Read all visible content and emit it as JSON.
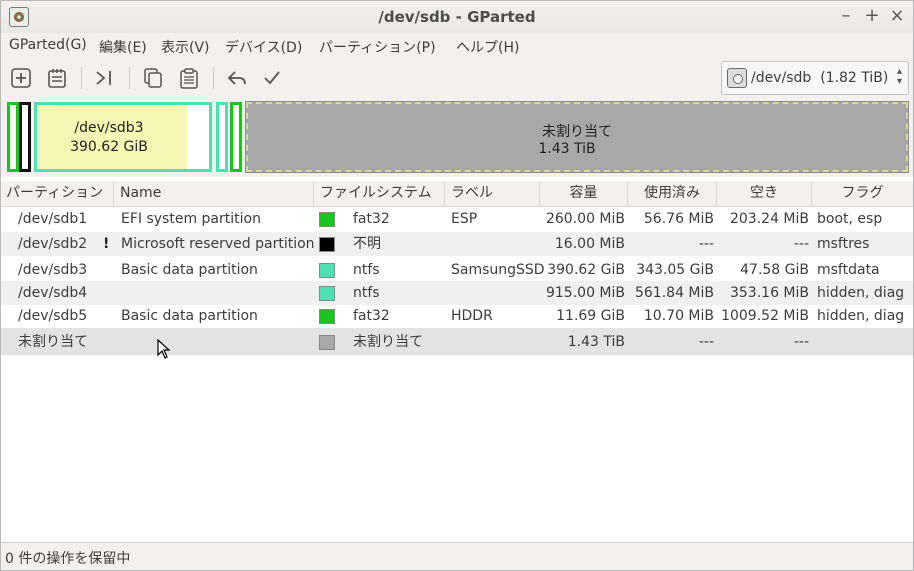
{
  "window": {
    "title": "/dev/sdb - GParted"
  },
  "menubar": {
    "items": [
      "GParted(G)",
      "編集(E)",
      "表示(V)",
      "デバイス(D)",
      "パーティション(P)",
      "ヘルプ(H)"
    ]
  },
  "toolbar": {
    "buttons": [
      "new-partition",
      "delete-partition",
      "resize-move",
      "copy",
      "paste",
      "undo",
      "apply"
    ],
    "device": "/dev/sdb",
    "device_size": "(1.82 TiB)"
  },
  "diskmap": {
    "sdb3": {
      "name": "/dev/sdb3",
      "size": "390.62 GiB"
    },
    "unallocated": {
      "name": "未割り当て",
      "size": "1.43 TiB"
    }
  },
  "table": {
    "headers": [
      "パーティション",
      "Name",
      "ファイルシステム",
      "ラベル",
      "容量",
      "使用済み",
      "空き",
      "フラグ"
    ],
    "rows": [
      {
        "partition": "/dev/sdb1",
        "warn": "",
        "name": "EFI system partition",
        "fs": "fat32",
        "fs_color": "#19c41d",
        "label": "ESP",
        "size": "260.00 MiB",
        "used": "56.76 MiB",
        "free": "203.24 MiB",
        "flags": "boot, esp"
      },
      {
        "partition": "/dev/sdb2",
        "warn": "!",
        "name": "Microsoft reserved partition",
        "fs": "不明",
        "fs_color": "#000000",
        "label": "",
        "size": "16.00 MiB",
        "used": "---",
        "free": "---",
        "flags": "msftres"
      },
      {
        "partition": "/dev/sdb3",
        "warn": "",
        "name": "Basic data partition",
        "fs": "ntfs",
        "fs_color": "#4ee0b0",
        "label": "SamsungSSD",
        "size": "390.62 GiB",
        "used": "343.05 GiB",
        "free": "47.58 GiB",
        "flags": "msftdata"
      },
      {
        "partition": "/dev/sdb4",
        "warn": "",
        "name": "",
        "fs": "ntfs",
        "fs_color": "#4ee0b0",
        "label": "",
        "size": "915.00 MiB",
        "used": "561.84 MiB",
        "free": "353.16 MiB",
        "flags": "hidden, diag"
      },
      {
        "partition": "/dev/sdb5",
        "warn": "",
        "name": "Basic data partition",
        "fs": "fat32",
        "fs_color": "#19c41d",
        "label": "HDDR",
        "size": "11.69 GiB",
        "used": "10.70 MiB",
        "free": "1009.52 MiB",
        "flags": "hidden, diag"
      },
      {
        "partition": "未割り当て",
        "warn": "",
        "name": "",
        "fs": "未割り当て",
        "fs_color": "#a8a8a8",
        "label": "",
        "size": "1.43 TiB",
        "used": "---",
        "free": "---",
        "flags": ""
      }
    ]
  },
  "statusbar": {
    "text": "0 件の操作を保留中"
  }
}
